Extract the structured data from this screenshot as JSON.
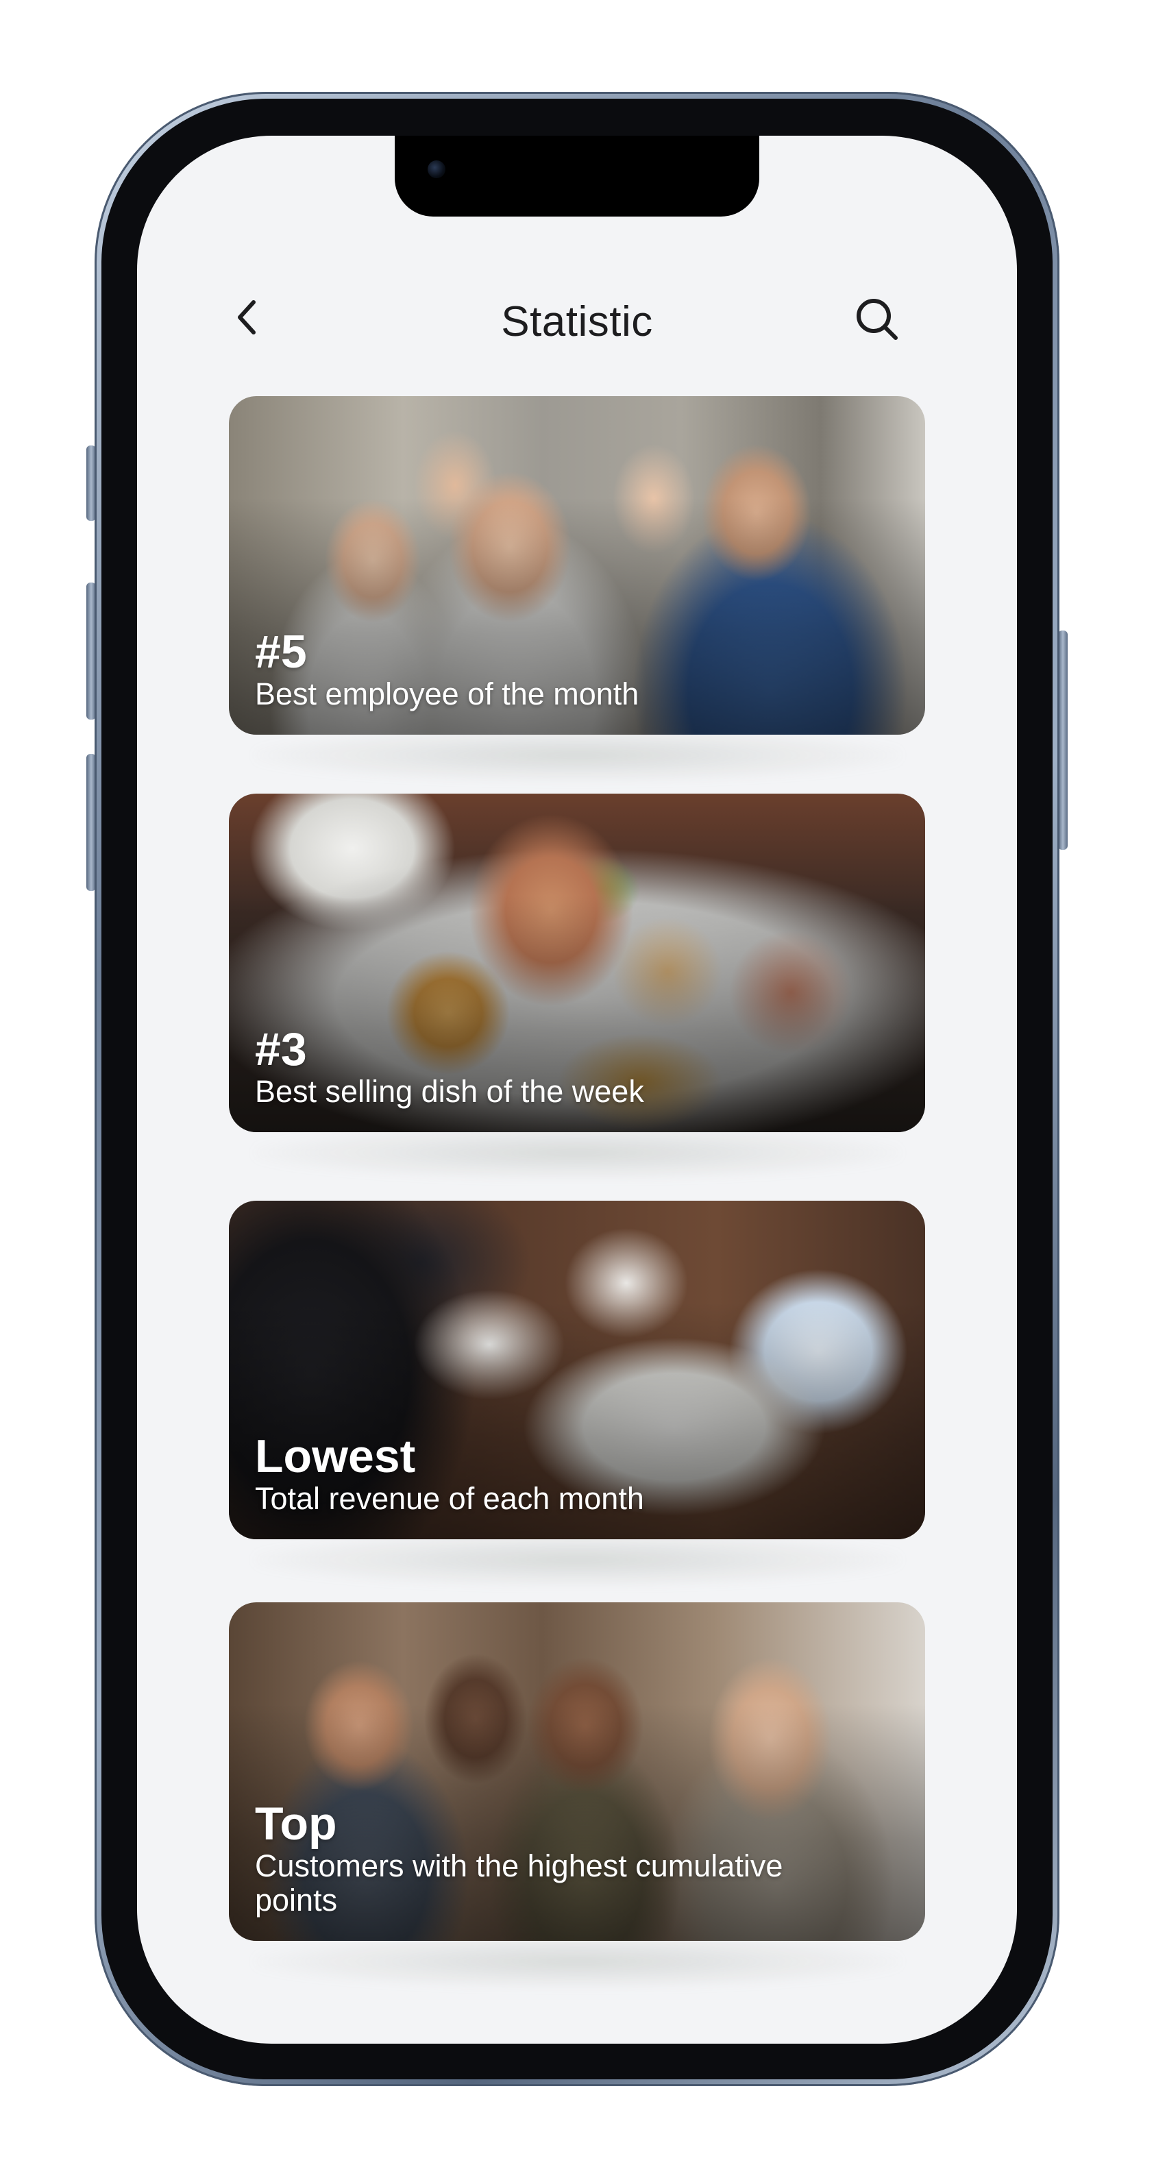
{
  "header": {
    "title": "Statistic",
    "back_icon": "chevron-left-icon",
    "search_icon": "search-icon"
  },
  "cards": [
    {
      "rank": "#5",
      "caption": "Best employee of the month",
      "image": "restaurant-staff-photo"
    },
    {
      "rank": "#3",
      "caption": "Best selling dish of the week",
      "image": "plated-dish-photo"
    },
    {
      "rank": "Lowest",
      "caption": "Total revenue of each month",
      "image": "business-meeting-photo"
    },
    {
      "rank": "Top",
      "caption": "Customers with the highest cumulative points",
      "image": "friends-dining-photo"
    }
  ],
  "colors": {
    "background": "#f3f4f6",
    "title_text": "#1d1d1f",
    "card_text": "#ffffff",
    "phone_frame": "#6d7f98"
  }
}
